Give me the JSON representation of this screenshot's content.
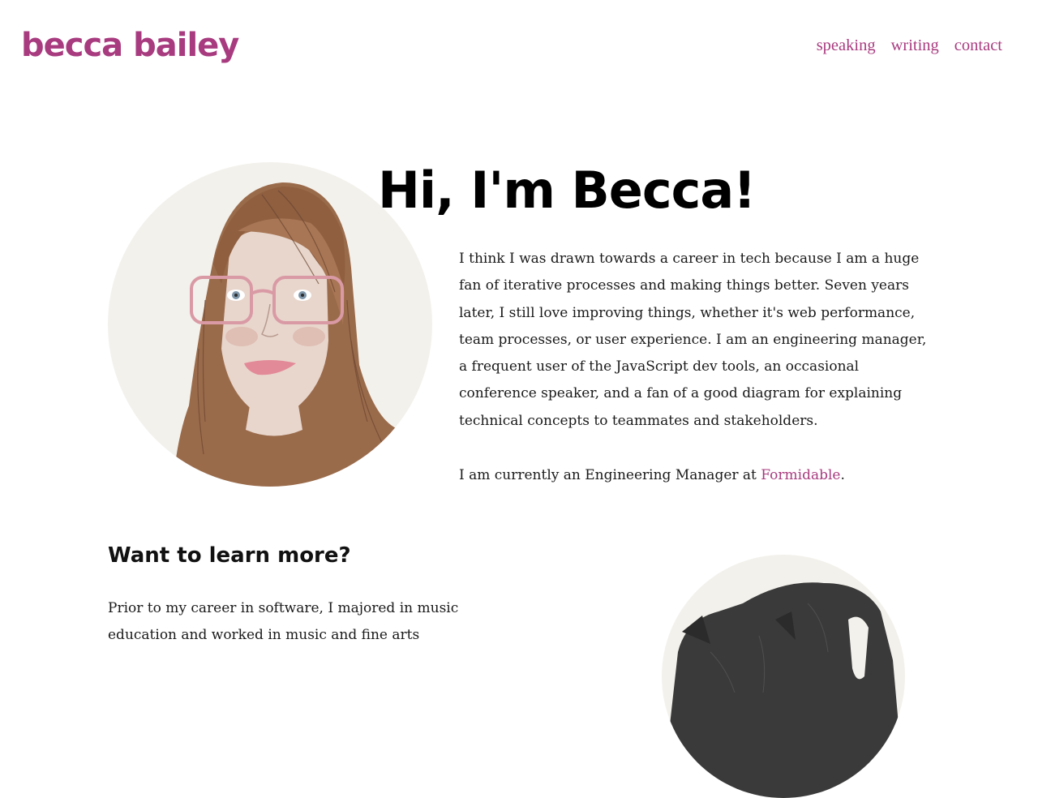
{
  "brand": "becca bailey",
  "nav": {
    "speaking": "speaking",
    "writing": "writing",
    "contact": "contact"
  },
  "hero": {
    "title": "Hi, I'm Becca!",
    "intro": "I think I was drawn towards a career in tech because I am a huge fan of iterative processes and making things better. Seven years later, I still love improving things, whether it's web performance, team processes, or user experience. I am an engineering manager, a frequent user of the JavaScript dev tools, an occasional conference speaker, and a fan of a good diagram for explaining technical concepts to teammates and stakeholders.",
    "current_prefix": "I am currently an Engineering Manager at ",
    "current_link": "Formidable",
    "current_suffix": "."
  },
  "more": {
    "heading": "Want to learn more?",
    "text": "Prior to my career in software, I majored in music education and worked in music and fine arts"
  },
  "colors": {
    "accent": "#a83b7f",
    "portrait_bg": "#f3f1ec"
  }
}
